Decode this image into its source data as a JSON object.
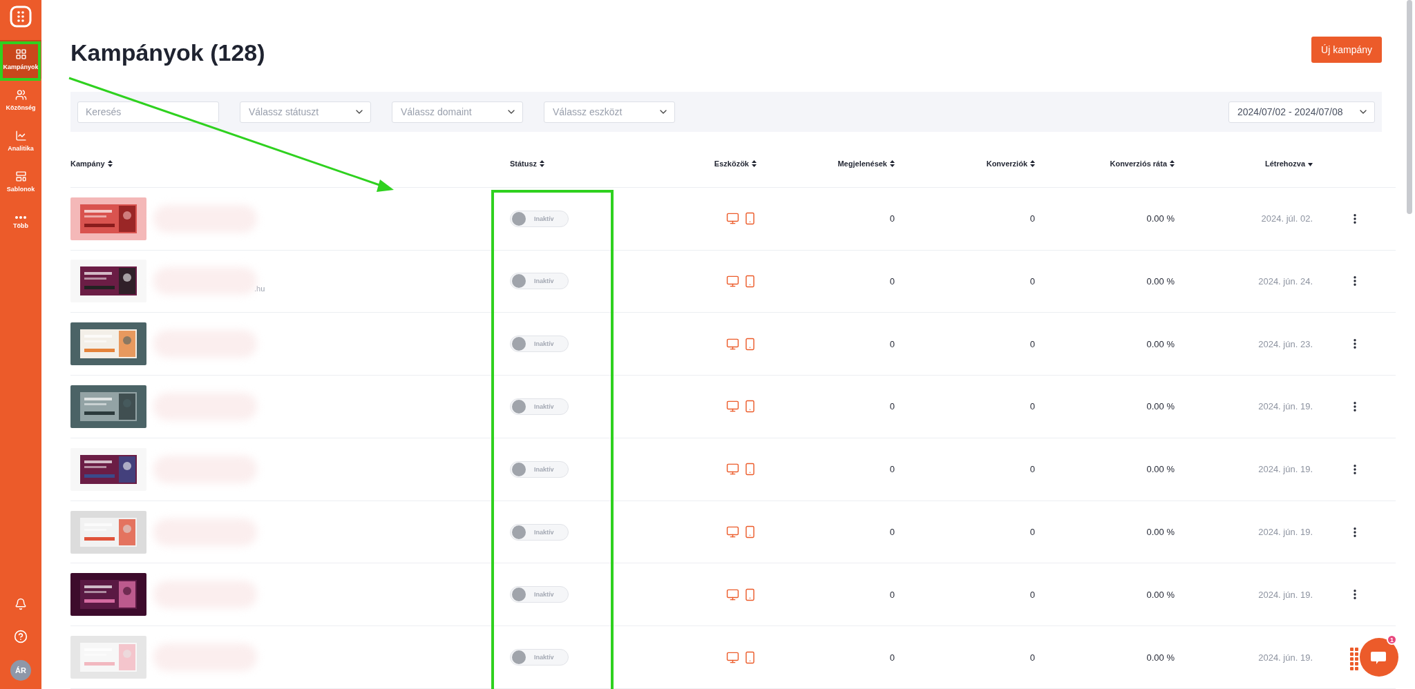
{
  "sidebar": {
    "items": [
      {
        "label": "Kampányok",
        "selected": true
      },
      {
        "label": "Közönség",
        "selected": false
      },
      {
        "label": "Analitika",
        "selected": false
      },
      {
        "label": "Sablonok",
        "selected": false
      },
      {
        "label": "Több",
        "selected": false
      }
    ],
    "avatar": "ÁR"
  },
  "page": {
    "title": "Kampányok (128)",
    "new_button": "Új kampány"
  },
  "filters": {
    "search": {
      "placeholder": "Keresés"
    },
    "selects": [
      {
        "placeholder": "Válassz státuszt"
      },
      {
        "placeholder": "Válassz domaint"
      },
      {
        "placeholder": "Válassz eszközt"
      }
    ],
    "date_range": "2024/07/02 - 2024/07/08"
  },
  "table": {
    "columns": [
      {
        "label": "Kampány",
        "sorted": false
      },
      {
        "label": "Státusz",
        "sorted": false
      },
      {
        "label": "Eszközök",
        "sorted": false
      },
      {
        "label": "Megjelenések",
        "sorted": false
      },
      {
        "label": "Konverziók",
        "sorted": false
      },
      {
        "label": "Konverziós ráta",
        "sorted": false
      },
      {
        "label": "Létrehozva",
        "sorted": true
      }
    ],
    "rows": [
      {
        "status": {
          "label": "Inaktív",
          "on": false
        },
        "impressions": "0",
        "conversions": "0",
        "rate": "0.00 %",
        "created": "2024. júl. 02."
      },
      {
        "name_suffix": ".hu",
        "status": {
          "label": "Inaktív",
          "on": false
        },
        "impressions": "0",
        "conversions": "0",
        "rate": "0.00 %",
        "created": "2024. jún. 24."
      },
      {
        "status": {
          "label": "Inaktív",
          "on": false
        },
        "impressions": "0",
        "conversions": "0",
        "rate": "0.00 %",
        "created": "2024. jún. 23."
      },
      {
        "status": {
          "label": "Inaktív",
          "on": false
        },
        "impressions": "0",
        "conversions": "0",
        "rate": "0.00 %",
        "created": "2024. jún. 19."
      },
      {
        "status": {
          "label": "Inaktív",
          "on": false
        },
        "impressions": "0",
        "conversions": "0",
        "rate": "0.00 %",
        "created": "2024. jún. 19."
      },
      {
        "status": {
          "label": "Inaktív",
          "on": false
        },
        "impressions": "0",
        "conversions": "0",
        "rate": "0.00 %",
        "created": "2024. jún. 19."
      },
      {
        "status": {
          "label": "Inaktív",
          "on": false
        },
        "impressions": "0",
        "conversions": "0",
        "rate": "0.00 %",
        "created": "2024. jún. 19."
      },
      {
        "status": {
          "label": "Inaktív",
          "on": false
        },
        "impressions": "0",
        "conversions": "0",
        "rate": "0.00 %",
        "created": "2024. jún. 19."
      }
    ]
  },
  "chat": {
    "badge": "1"
  }
}
